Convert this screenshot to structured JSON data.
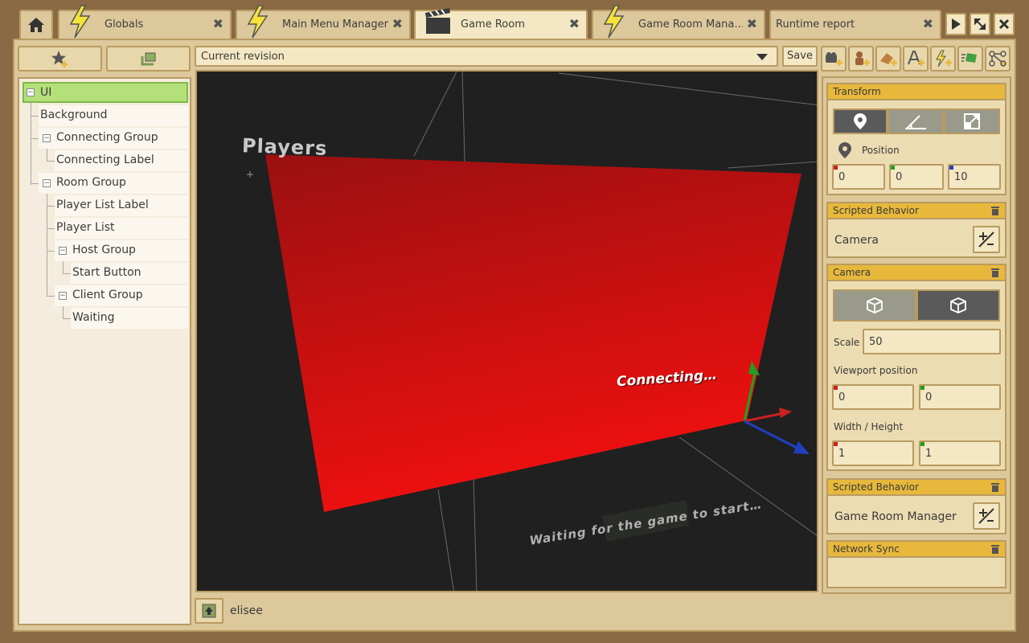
{
  "tabs": [
    {
      "label": "Globals",
      "icon": "lightning-icon"
    },
    {
      "label": "Main Menu Manager",
      "icon": "lightning-icon"
    },
    {
      "label": "Game Room",
      "icon": "clapperboard-icon"
    },
    {
      "label": "Game Room Mana…",
      "icon": "lightning-icon"
    },
    {
      "label": "Runtime report",
      "icon": ""
    }
  ],
  "window_controls": [
    "play-icon",
    "resize-icon",
    "close-icon"
  ],
  "revision": {
    "selected": "Current revision",
    "save_label": "Save"
  },
  "tree": [
    {
      "label": "UI",
      "selected": true
    },
    {
      "label": "Background"
    },
    {
      "label": "Connecting Group"
    },
    {
      "label": "Connecting Label"
    },
    {
      "label": "Room Group"
    },
    {
      "label": "Player List Label"
    },
    {
      "label": "Player List"
    },
    {
      "label": "Host Group"
    },
    {
      "label": "Start Button"
    },
    {
      "label": "Client Group"
    },
    {
      "label": "Waiting"
    }
  ],
  "viewport": {
    "players_text": "Players",
    "connecting_text": "Connecting…",
    "waiting_text": "Waiting for the game to start…",
    "plane_color": "#e01010"
  },
  "footer": {
    "user": "elisee"
  },
  "inspector": {
    "transform": {
      "title": "Transform",
      "position_label": "Position",
      "x": "0",
      "y": "0",
      "z": "10"
    },
    "scripted_behavior_1": {
      "title": "Scripted Behavior",
      "value": "Camera"
    },
    "camera": {
      "title": "Camera",
      "scale_label": "Scale",
      "scale": "50",
      "viewport_label": "Viewport position",
      "vx": "0",
      "vy": "0",
      "wh_label": "Width / Height",
      "w": "1",
      "h": "1"
    },
    "scripted_behavior_2": {
      "title": "Scripted Behavior",
      "value": "Game Room Manager"
    },
    "network_sync": {
      "title": "Network Sync"
    }
  },
  "colors": {
    "accent": "#e7b83c",
    "selected": "#b4e07a",
    "axis_x": "#cc2020",
    "axis_y": "#20a020",
    "axis_z": "#2040c0"
  }
}
